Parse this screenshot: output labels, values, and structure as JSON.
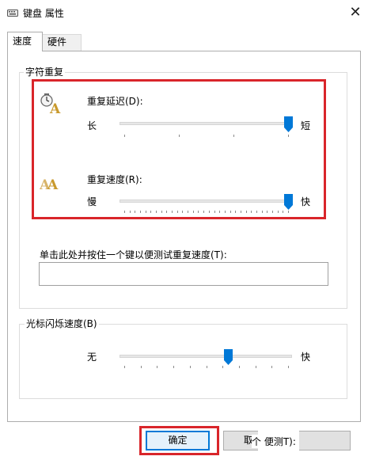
{
  "window": {
    "title": "键盘 属性",
    "close_label": "✕"
  },
  "tabs": [
    {
      "label": "速度",
      "active": true
    },
    {
      "label": "硬件",
      "active": false
    }
  ],
  "repeat_group": {
    "title": "字符重复",
    "delay": {
      "label": "重复延迟(D):",
      "min_label": "长",
      "max_label": "短",
      "value_fraction": 1.0
    },
    "rate": {
      "label": "重复速度(R):",
      "min_label": "慢",
      "max_label": "快",
      "value_fraction": 1.0
    },
    "test_label": "单击此处并按住一个键以便测试重复速度(T):",
    "test_value": ""
  },
  "cursor_group": {
    "title": "光标闪烁速度(B)",
    "min_label": "无",
    "max_label": "快",
    "value_fraction": 0.6
  },
  "buttons": {
    "ok_label": "确定",
    "cancel_label": "取",
    "apply_label": "个 便测T):"
  },
  "colors": {
    "accent": "#0078d7",
    "highlight_box": "#d9252a",
    "icon_gold": "#c99a2e"
  }
}
